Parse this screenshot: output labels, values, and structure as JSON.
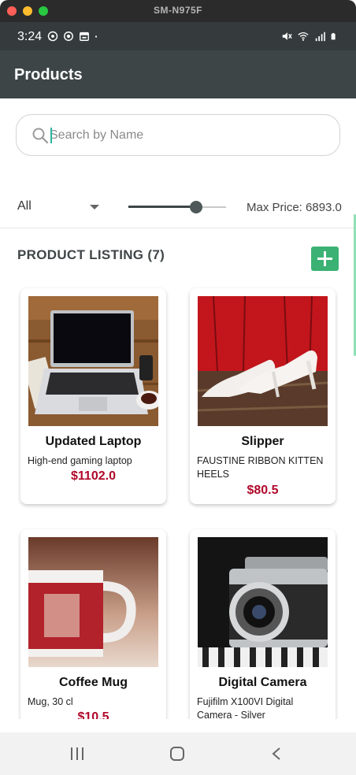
{
  "window": {
    "title": "SM-N975F"
  },
  "status_bar": {
    "time": "3:24",
    "left_icons": [
      "whatsapp-icon",
      "sync-icon",
      "calendar-icon",
      "dot-icon"
    ],
    "right_icons": [
      "mute-icon",
      "wifi-icon",
      "signal-icon",
      "battery-icon"
    ]
  },
  "appbar": {
    "title": "Products"
  },
  "search": {
    "placeholder": "Search by Name",
    "value": ""
  },
  "filter": {
    "category": "All",
    "slider_fraction": 0.69,
    "max_price_text": "Max Price: 6893.0"
  },
  "listing": {
    "title": "PRODUCT LISTING (7)",
    "add_label": "+"
  },
  "products": [
    {
      "name": "Updated Laptop",
      "description": "High-end gaming laptop",
      "price": "$1102.0",
      "image": "laptop"
    },
    {
      "name": "Slipper",
      "description": "FAUSTINE RIBBON KITTEN HEELS",
      "price": "$80.5",
      "image": "heels"
    },
    {
      "name": "Coffee Mug",
      "description": "Mug, 30 cl",
      "price": "$10.5",
      "image": "mug"
    },
    {
      "name": "Digital Camera",
      "description": "Fujifilm X100VI Digital Camera - Silver",
      "price": "",
      "image": "camera"
    }
  ],
  "colors": {
    "appbar": "#3d4546",
    "accent_green": "#3bb273",
    "price_red": "#b0082a"
  },
  "navbar": {
    "icons": [
      "recents-icon",
      "home-icon",
      "back-icon"
    ]
  }
}
